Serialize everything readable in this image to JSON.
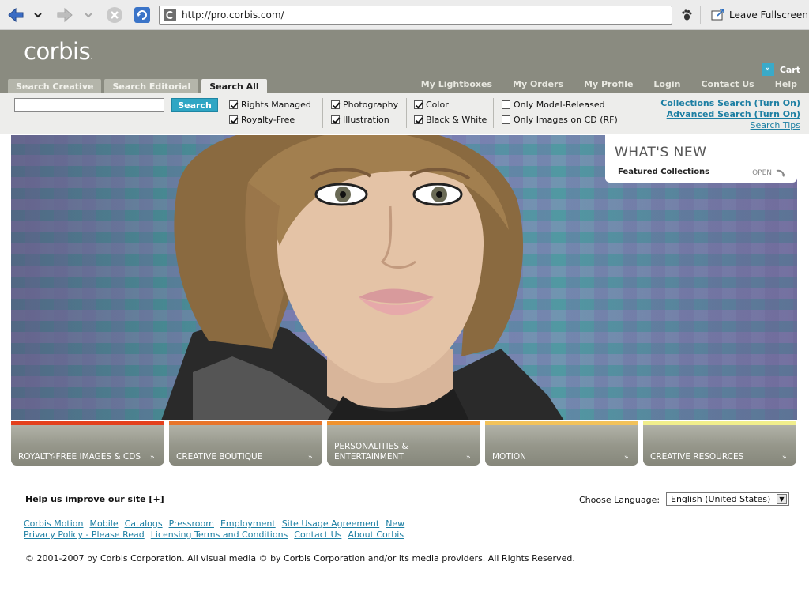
{
  "browser": {
    "url": "http://pro.corbis.com/",
    "leave_fullscreen_label": "Leave Fullscreen"
  },
  "site": {
    "logo_text": "corbis",
    "cart_label": "Cart",
    "tabs": [
      {
        "label": "Search Creative",
        "active": false
      },
      {
        "label": "Search Editorial",
        "active": false
      },
      {
        "label": "Search All",
        "active": true
      }
    ],
    "top_nav": [
      "My Lightboxes",
      "My Orders",
      "My Profile",
      "Login",
      "Contact Us",
      "Help"
    ]
  },
  "search": {
    "input_value": "",
    "button_label": "Search",
    "filters": {
      "rights_managed": {
        "label": "Rights Managed",
        "checked": true
      },
      "royalty_free": {
        "label": "Royalty-Free",
        "checked": true
      },
      "photography": {
        "label": "Photography",
        "checked": true
      },
      "illustration": {
        "label": "Illustration",
        "checked": true
      },
      "color": {
        "label": "Color",
        "checked": true
      },
      "black_white": {
        "label": "Black & White",
        "checked": true
      },
      "model_released": {
        "label": "Only Model-Released",
        "checked": false
      },
      "images_on_cd": {
        "label": "Only Images on CD (RF)",
        "checked": false
      }
    },
    "collections_search": "Collections Search (Turn On)",
    "advanced_search": "Advanced Search (Turn On)",
    "search_tips": "Search Tips"
  },
  "whats_new": {
    "title": "WHAT'S NEW",
    "subtitle": "Featured Collections",
    "open_label": "OPEN"
  },
  "categories": [
    {
      "label": "Royalty-Free Images & CDs",
      "color": "#e4401c"
    },
    {
      "label": "Creative Boutique",
      "color": "#e8742a"
    },
    {
      "label": "Personalities & Entertainment",
      "color": "#f0922e"
    },
    {
      "label": "Motion",
      "color": "#f2c25a"
    },
    {
      "label": "Creative Resources",
      "color": "#f1ee8c"
    }
  ],
  "footer": {
    "improve_label": "Help us improve our site",
    "improve_toggle": "[+]",
    "language_label": "Choose Language:",
    "language_value": "English (United States)",
    "links_row1": [
      "Corbis Motion",
      "Mobile",
      "Catalogs",
      "Pressroom",
      "Employment",
      "Site Usage Agreement",
      "New"
    ],
    "links_row2": [
      "Privacy Policy - Please Read",
      "Licensing Terms and Conditions",
      "Contact Us",
      "About Corbis"
    ],
    "copyright": "© 2001-2007 by Corbis Corporation. All visual media © by Corbis Corporation and/or its media providers. All Rights Reserved."
  },
  "colors": {
    "header_bg": "#8a8b80",
    "accent": "#2fa6c4",
    "link": "#1d7fa3"
  }
}
